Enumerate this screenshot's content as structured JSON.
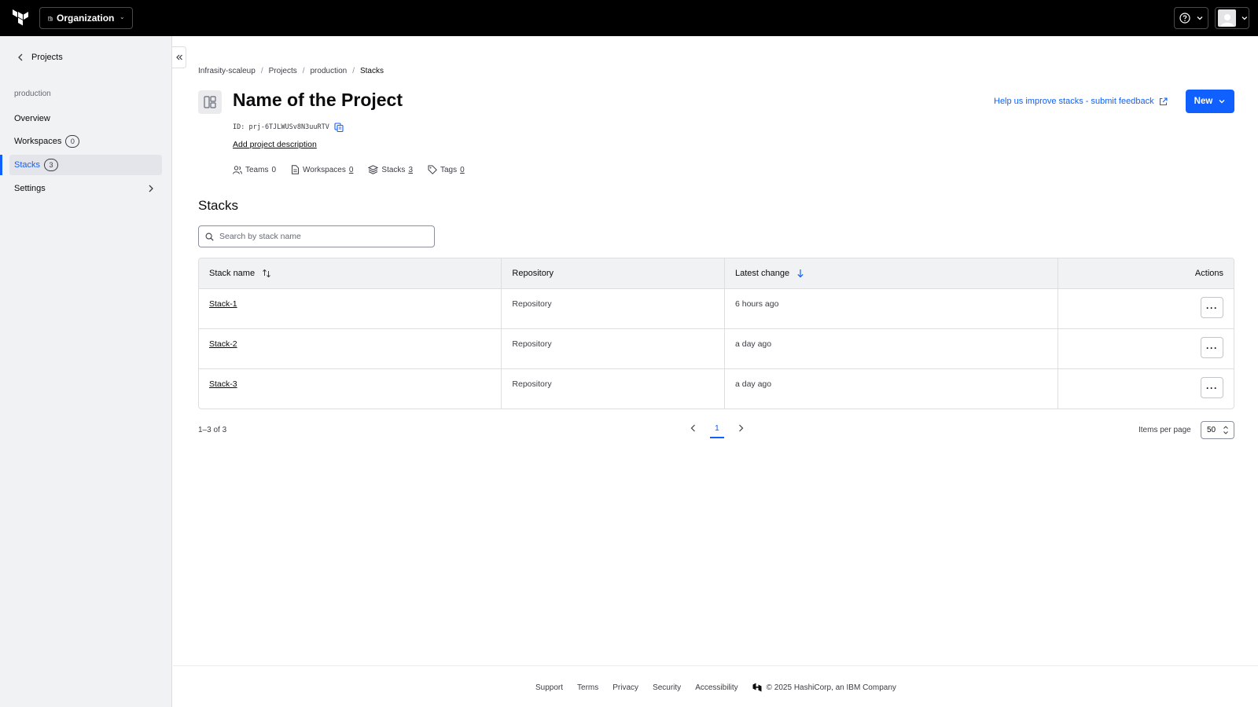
{
  "topbar": {
    "org_label": "Organization"
  },
  "sidebar": {
    "back_label": "Projects",
    "heading": "production",
    "items": [
      {
        "label": "Overview"
      },
      {
        "label": "Workspaces",
        "count": "0"
      },
      {
        "label": "Stacks",
        "count": "3"
      },
      {
        "label": "Settings"
      }
    ]
  },
  "breadcrumb": [
    "Infrasity-scaleup",
    "Projects",
    "production",
    "Stacks"
  ],
  "project": {
    "title": "Name of the Project",
    "id": "ID: prj-6TJLWUSv8N3uuRTV",
    "add_description": "Add project description",
    "meta": {
      "teams_label": "Teams",
      "teams_count": "0",
      "workspaces_label": "Workspaces",
      "workspaces_count": "0",
      "stacks_label": "Stacks",
      "stacks_count": "3",
      "tags_label": "Tags",
      "tags_count": "0"
    }
  },
  "feedback_link": "Help us improve stacks - submit feedback",
  "new_button": "New",
  "stacks": {
    "title": "Stacks",
    "search_placeholder": "Search by stack name",
    "columns": [
      "Stack name",
      "Repository",
      "Latest change",
      "Actions"
    ],
    "rows": [
      {
        "name": "Stack-1",
        "repository": "Repository",
        "latest_change": "6 hours ago"
      },
      {
        "name": "Stack-2",
        "repository": "Repository",
        "latest_change": "a day ago"
      },
      {
        "name": "Stack-3",
        "repository": "Repository",
        "latest_change": "a day ago"
      }
    ],
    "more_label": "···"
  },
  "pagination": {
    "range": "1–3 of 3",
    "current_page": "1",
    "items_per_page_label": "Items per page",
    "items_per_page": "50"
  },
  "footer": {
    "links": [
      "Support",
      "Terms",
      "Privacy",
      "Security",
      "Accessibility"
    ],
    "copyright": "© 2025 HashiCorp, an IBM Company"
  },
  "colors": {
    "accent": "#1060ff",
    "topbar": "#000000",
    "sidebar_bg": "#f1f2f3"
  }
}
